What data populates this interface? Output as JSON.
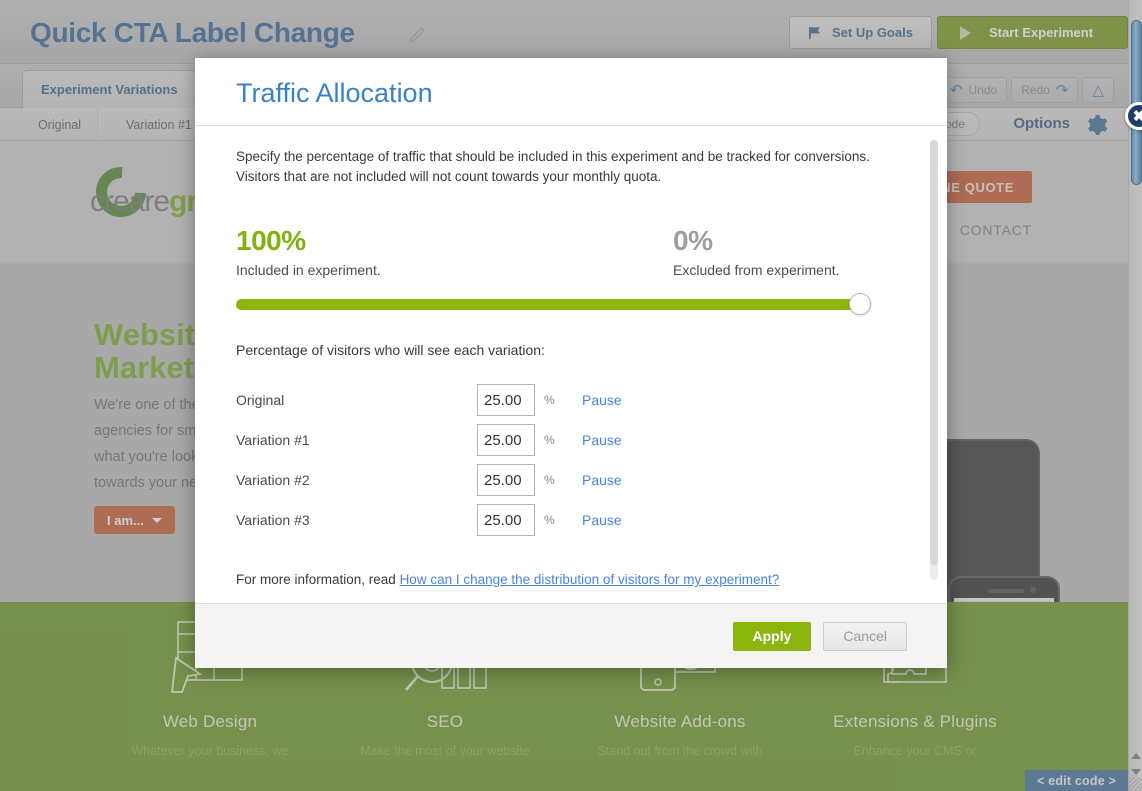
{
  "app": {
    "experiment_title": "Quick CTA Label Change",
    "edit_title_icon": "pencil-icon",
    "setup_goals_label": "Set Up Goals",
    "start_experiment_label": "Start Experiment",
    "tab_experiment_variations": "Experiment Variations",
    "undo_label": "Undo",
    "redo_label": "Redo",
    "collapse_icon": "chevron-double-up-icon",
    "variation_tabs": [
      "Original",
      "Variation #1"
    ],
    "interactive_mode_label": "ractive Mode",
    "options_label": "Options",
    "gear_icon": "gear-icon"
  },
  "site_preview": {
    "logo_text_a": "creare",
    "logo_text_b": "gro",
    "quote_button": "NE QUOTE",
    "nav_contact": "CONTACT",
    "hero_heading_line1": "Website",
    "hero_heading_line2": "Marketi",
    "hero_paragraph": "We're one of the\nagencies for sm\nwhat you're look\ntowards your ne",
    "hero_cta": "I am...",
    "features": [
      {
        "title": "Web Design",
        "sub": "Whatever your business, we",
        "icon": "cursor-wireframe-icon"
      },
      {
        "title": "SEO",
        "sub": "Make the most of your website",
        "icon": "magnifier-bars-icon"
      },
      {
        "title": "Website Add-ons",
        "sub": "Stand out from the crowd with",
        "icon": "mobile-play-icon"
      },
      {
        "title": "Extensions & Plugins",
        "sub": "Enhance your CMS or",
        "icon": "puzzle-icon"
      }
    ],
    "edit_code_label": "< edit code >"
  },
  "modal": {
    "title": "Traffic Allocation",
    "close_icon": "close-icon",
    "intro": "Specify the percentage of traffic that should be included in this experiment and be tracked for conversions. Visitors that are not included will not count towards your monthly quota.",
    "included_value": "100%",
    "included_label": "Included in experiment.",
    "excluded_value": "0%",
    "excluded_label": "Excluded from experiment.",
    "slider_percent": 100,
    "distribution_label": "Percentage of visitors who will see each variation:",
    "variations": [
      {
        "name": "Original",
        "percent": "25.00",
        "unit": "%",
        "action": "Pause"
      },
      {
        "name": "Variation #1",
        "percent": "25.00",
        "unit": "%",
        "action": "Pause"
      },
      {
        "name": "Variation #2",
        "percent": "25.00",
        "unit": "%",
        "action": "Pause"
      },
      {
        "name": "Variation #3",
        "percent": "25.00",
        "unit": "%",
        "action": "Pause"
      }
    ],
    "more_info_prefix": "For more information, read ",
    "more_info_link": "How can I change the distribution of visitors for my experiment?",
    "apply_label": "Apply",
    "cancel_label": "Cancel"
  },
  "colors": {
    "accent_green": "#8cb50d",
    "brand_blue": "#205493",
    "link_blue": "#4b84d6",
    "orange_cta": "#c0491d",
    "modal_title_blue": "#3b82c4"
  }
}
